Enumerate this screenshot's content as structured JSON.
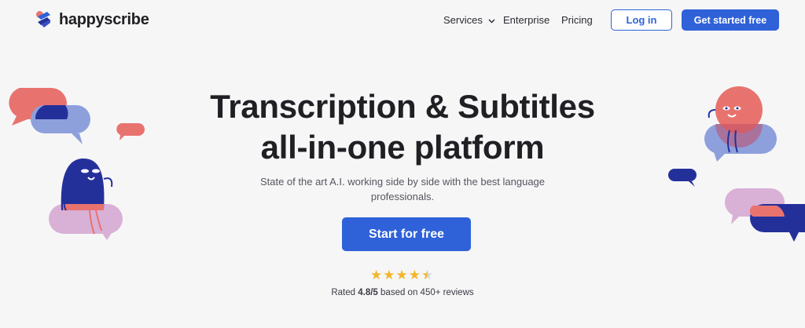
{
  "brand": {
    "name": "happyscribe"
  },
  "nav": {
    "services": "Services",
    "enterprise": "Enterprise",
    "pricing": "Pricing",
    "login": "Log in",
    "get_started": "Get started free"
  },
  "hero": {
    "title_line1": "Transcription & Subtitles",
    "title_line2": "all-in-one platform",
    "subtitle": "State of the art A.I. working side by side with the best language professionals.",
    "cta": "Start for free"
  },
  "rating": {
    "stars": 4.5,
    "prefix": "Rated",
    "score": "4.8/5",
    "suffix": "based on 450+ reviews"
  },
  "colors": {
    "accent": "#2f62d8",
    "star": "#f2b628",
    "coral": "#e8736e",
    "lavender": "#8ea0dc",
    "navy": "#24309a",
    "pink": "#d9b0d6"
  }
}
